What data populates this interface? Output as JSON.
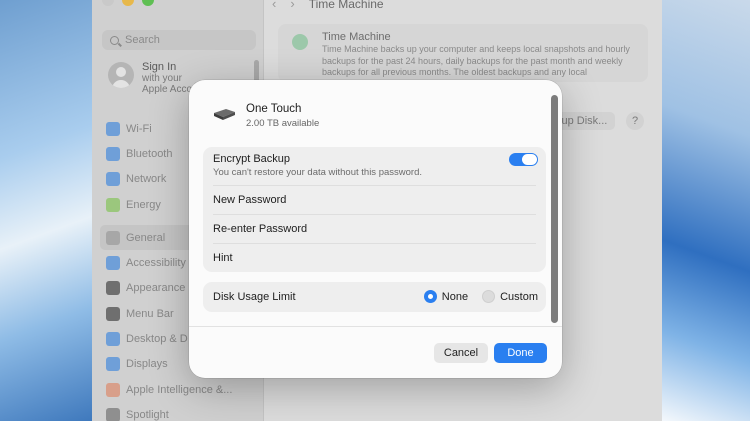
{
  "window": {
    "title": "Time Machine",
    "back_glyph": "‹",
    "forward_glyph": "›",
    "search_placeholder": "Search"
  },
  "sidebar": {
    "signin": {
      "title": "Sign In",
      "line1": "with your",
      "line2": "Apple Acco"
    },
    "items": [
      {
        "label": "Wi-Fi",
        "color": "#6f9fd8"
      },
      {
        "label": "Bluetooth",
        "color": "#6f9fd8"
      },
      {
        "label": "Network",
        "color": "#6f9fd8"
      },
      {
        "label": "Energy",
        "color": "#9bc77d"
      },
      {
        "label": "General",
        "color": "#a7a7a7"
      },
      {
        "label": "Accessibility",
        "color": "#6f9fd8"
      },
      {
        "label": "Appearance",
        "color": "#6f6f6f"
      },
      {
        "label": "Menu Bar",
        "color": "#6f6f6f"
      },
      {
        "label": "Desktop & D",
        "color": "#6f9fd8"
      },
      {
        "label": "Displays",
        "color": "#6f9fd8"
      },
      {
        "label": "Apple Intelligence &...",
        "color": "#d89f8a"
      },
      {
        "label": "Spotlight",
        "color": "#8f8f8f"
      }
    ]
  },
  "time_machine": {
    "title": "Time Machine",
    "description": "Time Machine backs up your computer and keeps local snapshots and hourly backups for the past 24 hours, daily backups for the past month and weekly backups for all previous months. The oldest backups and any local",
    "add_backup_label": "kup Disk...",
    "help_label": "?"
  },
  "dialog": {
    "drive_name": "One Touch",
    "drive_available": "2.00 TB available",
    "encrypt_title": "Encrypt Backup",
    "encrypt_subtitle": "You can't restore your data without this password.",
    "encrypt_enabled": true,
    "new_password_label": "New Password",
    "reenter_password_label": "Re-enter Password",
    "hint_label": "Hint",
    "disk_usage_label": "Disk Usage Limit",
    "radio_none": "None",
    "radio_custom": "Custom",
    "selected_option": "None",
    "cancel_label": "Cancel",
    "done_label": "Done"
  },
  "colors": {
    "accent": "#2a7ff0"
  }
}
